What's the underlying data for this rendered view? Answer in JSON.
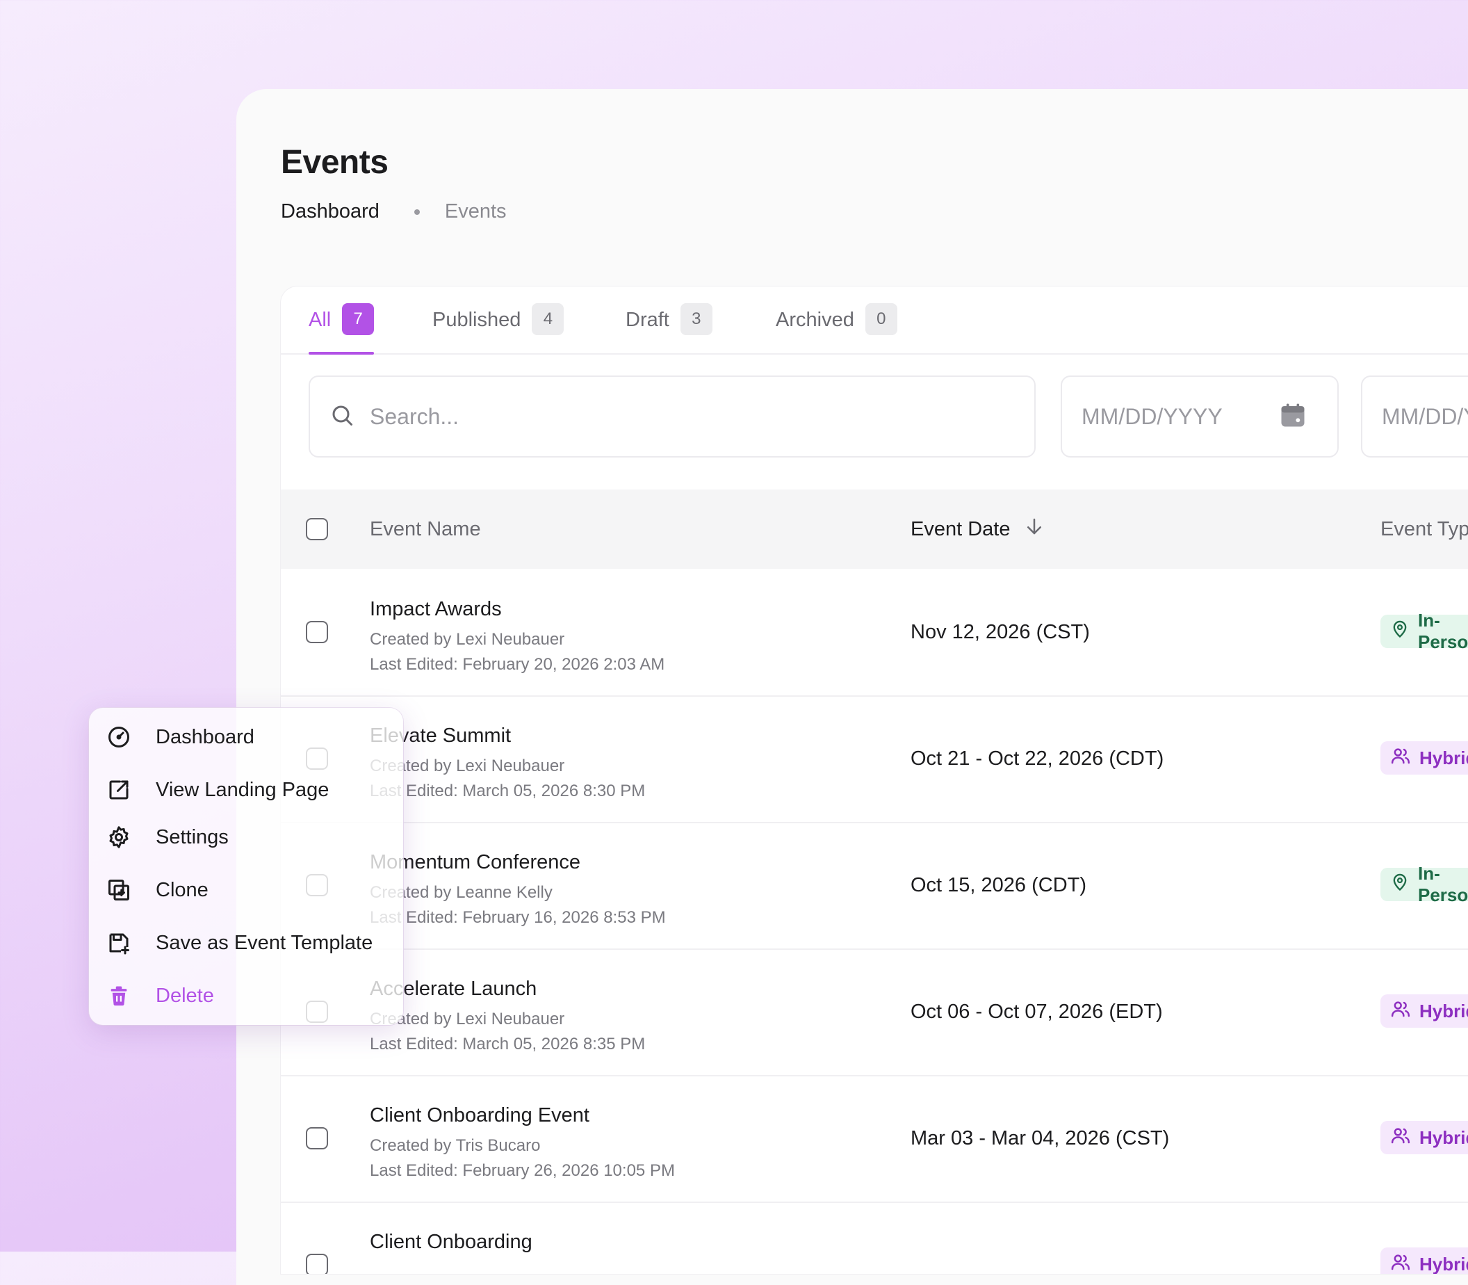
{
  "header": {
    "title": "Events",
    "breadcrumb": {
      "parent": "Dashboard",
      "current": "Events"
    }
  },
  "tabs": [
    {
      "label": "All",
      "count": "7",
      "active": true
    },
    {
      "label": "Published",
      "count": "4",
      "active": false
    },
    {
      "label": "Draft",
      "count": "3",
      "active": false
    },
    {
      "label": "Archived",
      "count": "0",
      "active": false
    }
  ],
  "filters": {
    "search_placeholder": "Search...",
    "date_from_placeholder": "MM/DD/YYYY",
    "date_to_placeholder": "MM/DD/YYYY"
  },
  "table": {
    "columns": {
      "name": "Event Name",
      "date": "Event Date",
      "type": "Event Type"
    },
    "rows": [
      {
        "name": "Impact Awards",
        "creator": "Created by Lexi Neubauer",
        "edited": "Last Edited: February 20, 2026 2:03 AM",
        "date": "Nov 12, 2026 (CST)",
        "type": "In-Person",
        "type_icon": "location-pin-icon"
      },
      {
        "name": "Elevate Summit",
        "creator": "Created by Lexi Neubauer",
        "edited": "Last Edited: March 05, 2026 8:30 PM",
        "date": "Oct 21 - Oct 22, 2026 (CDT)",
        "type": "Hybrid",
        "type_icon": "users-icon"
      },
      {
        "name": "Momentum Conference",
        "creator": "Created by Leanne Kelly",
        "edited": "Last Edited: February 16, 2026 8:53 PM",
        "date": "Oct 15, 2026 (CDT)",
        "type": "In-Person",
        "type_icon": "location-pin-icon"
      },
      {
        "name": "Accelerate Launch",
        "creator": "Created by Lexi Neubauer",
        "edited": "Last Edited: March 05, 2026 8:35 PM",
        "date": "Oct 06 - Oct 07, 2026 (EDT)",
        "type": "Hybrid",
        "type_icon": "users-icon"
      },
      {
        "name": "Client Onboarding Event",
        "creator": "Created by Tris Bucaro",
        "edited": "Last Edited: February 26, 2026 10:05 PM",
        "date": "Mar 03 - Mar 04, 2026 (CST)",
        "type": "Hybrid",
        "type_icon": "users-icon"
      },
      {
        "name": "Client Onboarding",
        "creator": "",
        "edited": "",
        "date": "",
        "type": "Hybrid",
        "type_icon": "users-icon"
      }
    ]
  },
  "context_menu": {
    "items": [
      {
        "label": "Dashboard",
        "icon": "dashboard-gauge-icon"
      },
      {
        "label": "View Landing Page",
        "icon": "external-link-icon"
      },
      {
        "label": "Settings",
        "icon": "gear-icon"
      },
      {
        "label": "Clone",
        "icon": "clone-icon"
      },
      {
        "label": "Save as Event Template",
        "icon": "save-template-icon"
      },
      {
        "label": "Delete",
        "icon": "trash-icon"
      }
    ]
  },
  "colors": {
    "accent": "#b252e6",
    "in_person_bg": "#e4f6ec",
    "in_person_fg": "#1e6b47",
    "hybrid_bg": "#f5e8fc",
    "hybrid_fg": "#8d2fc0"
  }
}
